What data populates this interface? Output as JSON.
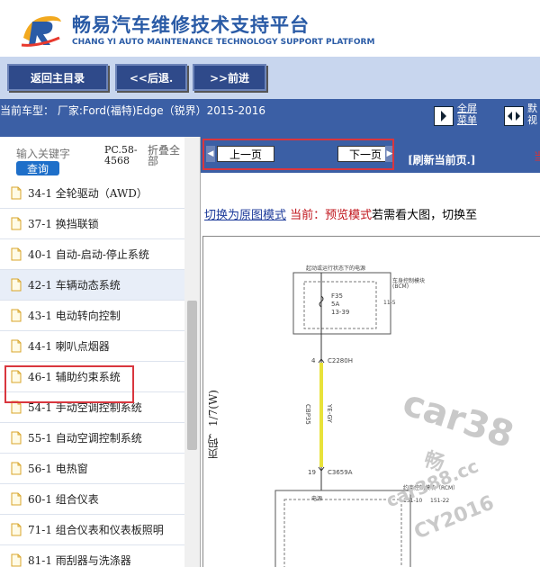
{
  "header": {
    "title_cn": "畅易汽车维修技术支持平台",
    "title_en": "CHANG YI AUTO MAINTENANCE TECHNOLOGY SUPPORT PLATFORM"
  },
  "toolbar": {
    "home_label": "返回主目录",
    "back_label": "<<后退.",
    "forward_label": ">>前进"
  },
  "carbar": {
    "car_text": "当前车型： 厂家:Ford(福特)Edge（锐界）2015-2016",
    "fullscreen_label": "全屏\n菜单",
    "split_label": "默\n视"
  },
  "sidebar": {
    "search_placeholder": "输入关键字",
    "search_button": "查询",
    "code_label": "PC.58-4568",
    "fold_label": "折叠全部",
    "items": [
      {
        "label": "34-1 全轮驱动（AWD）"
      },
      {
        "label": "37-1 换挡联锁"
      },
      {
        "label": "40-1 自动-启动-停止系统"
      },
      {
        "label": "42-1 车辆动态系统"
      },
      {
        "label": "43-1 电动转向控制"
      },
      {
        "label": "44-1 喇叭点烟器"
      },
      {
        "label": "46-1 辅助约束系统"
      },
      {
        "label": "54-1 手动空调控制系统"
      },
      {
        "label": "55-1 自动空调控制系统"
      },
      {
        "label": "56-1 电热窗"
      },
      {
        "label": "60-1 组合仪表"
      },
      {
        "label": "71-1 组合仪表和仪表板照明"
      },
      {
        "label": "81-1 雨刮器与洗涤器"
      }
    ]
  },
  "pager": {
    "prev_label": "上一页",
    "next_label": "下一页",
    "refresh_label": "[刷新当前页.]",
    "current_label": "当"
  },
  "mode": {
    "switch_link": "切换为原图模式",
    "current_text": " 当前：预览模式",
    "tail_text": "若需看大图，切换至"
  },
  "diagram": {
    "page_label": "页码，1/7(W)",
    "power_label": "起动或运行状态下的电源",
    "bcm_label": "车身控制模块",
    "bcm_abbr": "(BCM)",
    "fuse_label": "F35",
    "fuse_amp": "5A",
    "fuse_pin": "13-39",
    "pin_right": "11-5",
    "pin_4": "4",
    "conn_1": "C2280H",
    "wire_id": "CBP35",
    "wire_color": "YE-GY",
    "pin_19": "19",
    "conn_2": "C3659A",
    "rcm_label": "约束控制模块（RCM）",
    "power_small": "电源",
    "pin_a": "151-10",
    "pin_b": "151-22",
    "wire_hex": "#e8e23a",
    "watermark_1": "car38",
    "watermark_2": "畅",
    "watermark_3": "car388.cc",
    "watermark_4": "CY2016"
  }
}
